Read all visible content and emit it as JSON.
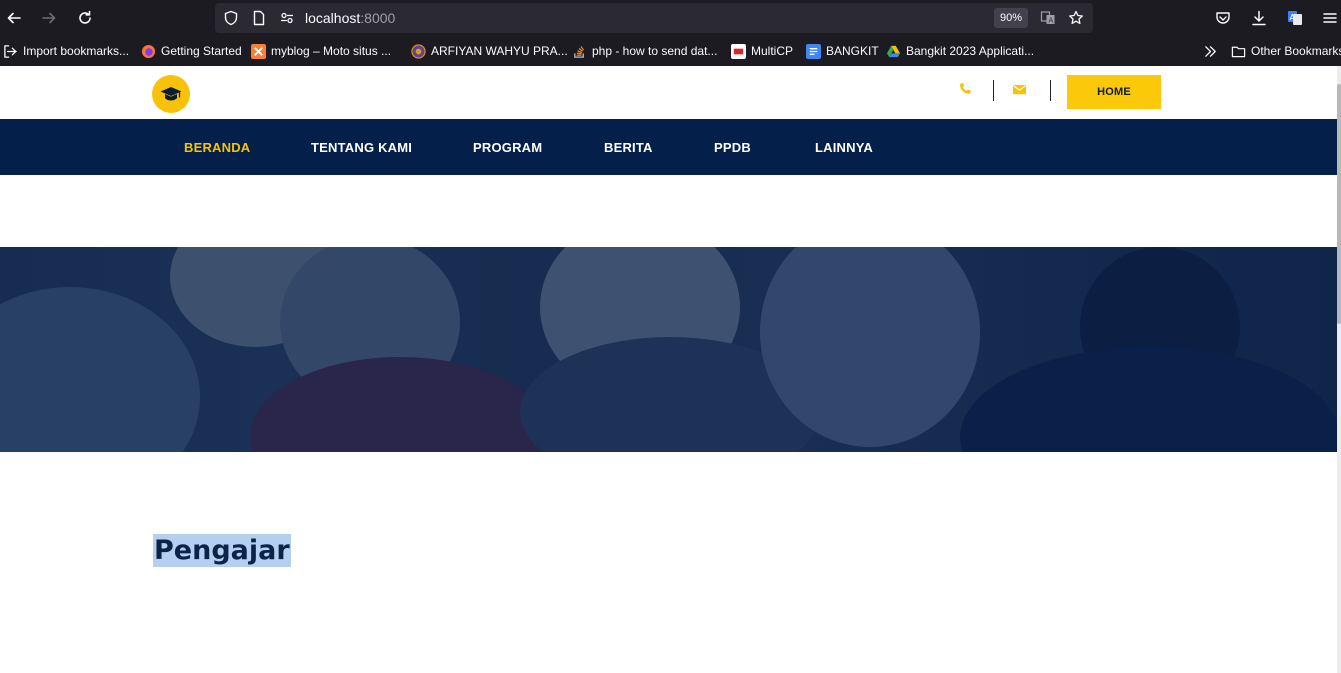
{
  "browser": {
    "url_host": "localhost",
    "url_port": ":8000",
    "zoom": "90%",
    "bookmarks": [
      {
        "label": "Import bookmarks..."
      },
      {
        "label": "Getting Started"
      },
      {
        "label": "myblog – Moto situs ..."
      },
      {
        "label": "ARFIYAN WAHYU PRA..."
      },
      {
        "label": "php - how to send dat..."
      },
      {
        "label": "MultiCP"
      },
      {
        "label": "BANGKIT"
      },
      {
        "label": "Bangkit 2023 Applicati..."
      }
    ],
    "other_bookmarks": "Other Bookmarks"
  },
  "header": {
    "home_button": "HOME",
    "accent_color": "#f9c20a"
  },
  "nav": {
    "items": [
      {
        "label": "BERANDA",
        "active": true
      },
      {
        "label": "TENTANG KAMI",
        "active": false
      },
      {
        "label": "PROGRAM",
        "active": false
      },
      {
        "label": "BERITA",
        "active": false
      },
      {
        "label": "PPDB",
        "active": false
      },
      {
        "label": "LAINNYA",
        "active": false
      }
    ],
    "background": "#04204a"
  },
  "content": {
    "section_title": "Pengajar"
  }
}
